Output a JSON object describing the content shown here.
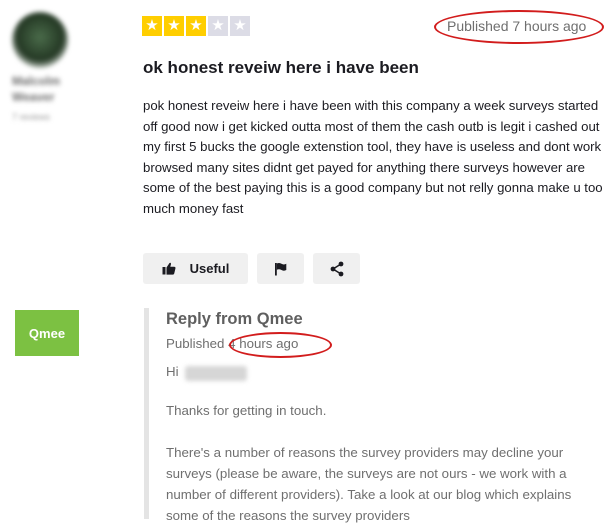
{
  "reviewer": {
    "name_line1": "Malcolm",
    "name_line2": "Weaver",
    "review_count": "7 reviews"
  },
  "review": {
    "rating": 3,
    "rating_max": 5,
    "published": "Published 7 hours ago",
    "title": "ok honest reveiw here i have been",
    "body": "pok honest reveiw here i have been with this company a week surveys started off good now i get kicked outta most of them the cash outb is legit i cashed out my first 5 bucks the google extenstion tool, they have is useless and dont work browsed many sites didnt get payed for anything there surveys however are some of the best paying this is a good company but not relly gonna make u too much money fast"
  },
  "actions": {
    "useful_label": "Useful",
    "useful_icon": "thumbs-up-icon",
    "flag_icon": "flag-icon",
    "share_icon": "share-icon"
  },
  "reply": {
    "logo_text": "Qmee",
    "title": "Reply from Qmee",
    "published_prefix": "Published",
    "published_time": "4 hours ago",
    "greeting": "Hi",
    "thanks": "Thanks for getting in touch.",
    "body": "There's a number of reasons the survey providers may decline your surveys (please be aware, the surveys are not ours - we work with a number of different providers). Take a look at our blog which explains some of the reasons the survey providers"
  },
  "colors": {
    "star_on": "#ffce00",
    "star_off": "#dcdce6",
    "annotation_red": "#d21c1c",
    "qmee_green": "#7cc142"
  }
}
